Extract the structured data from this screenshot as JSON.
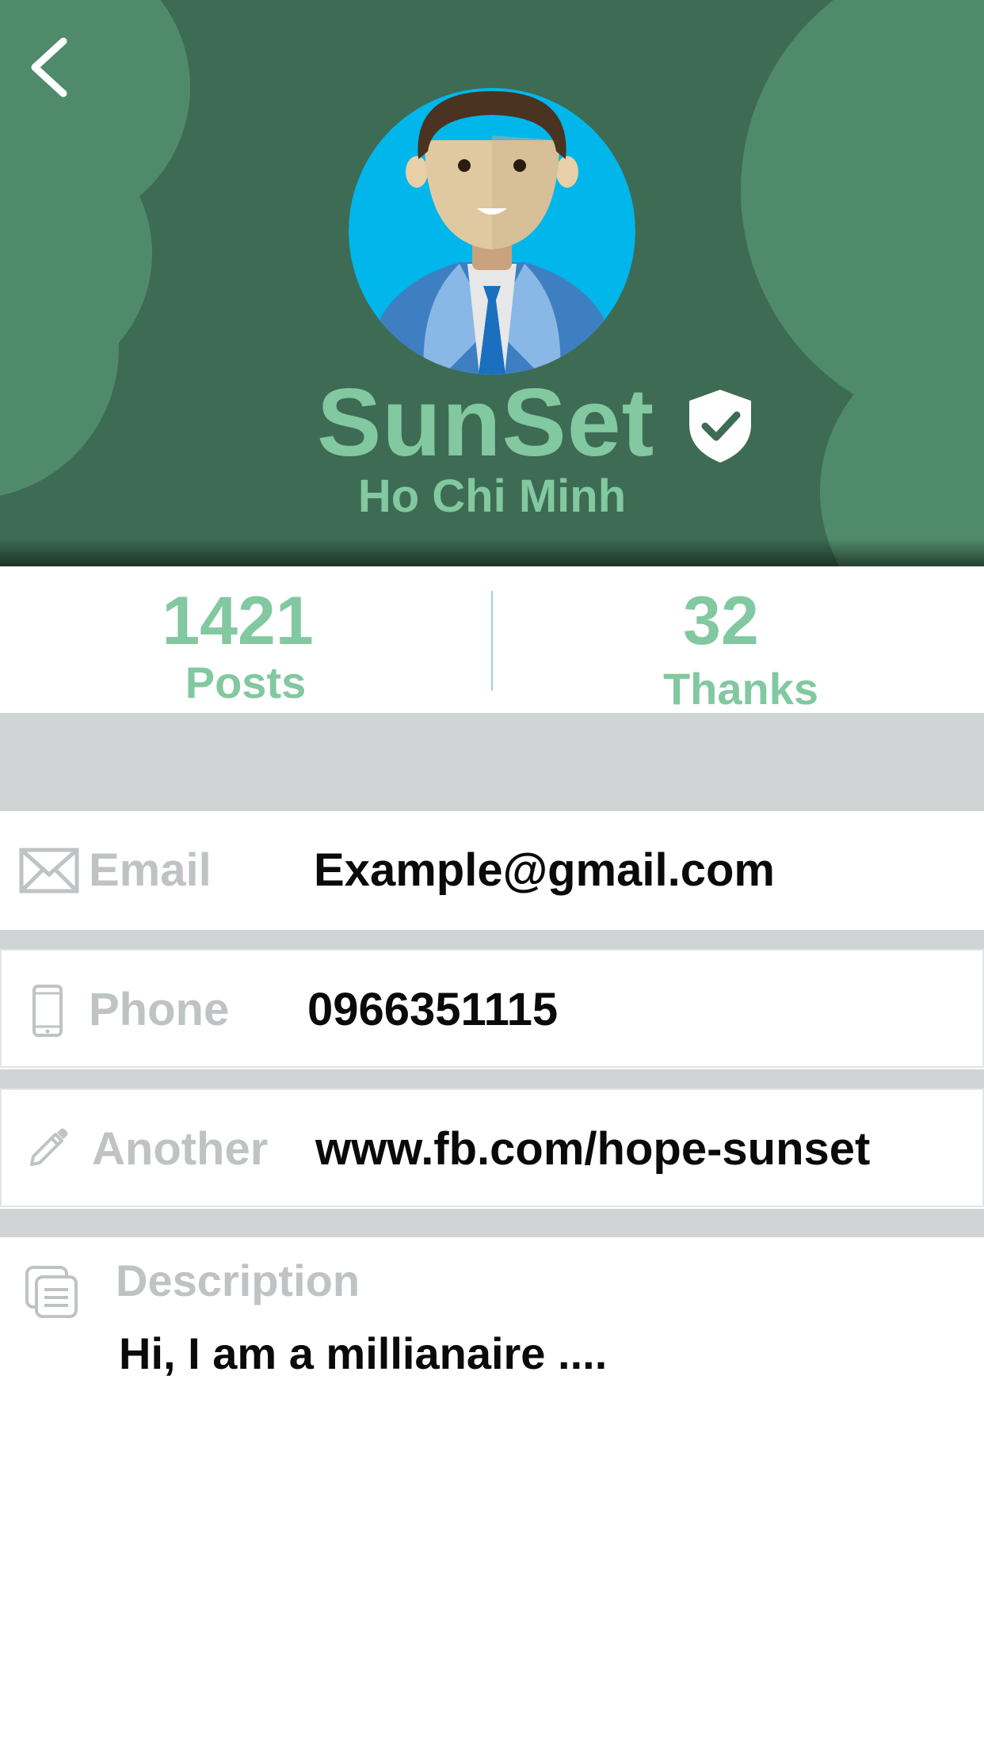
{
  "header": {
    "back_icon": "chevron-left-icon",
    "avatar_icon": "businessman-avatar",
    "name": "SunSet",
    "verified_icon": "shield-check-icon",
    "location": "Ho Chi Minh",
    "colors": {
      "background": "#3e6b53",
      "decoration": "#4f8a6b",
      "accent": "#82c8a0"
    }
  },
  "stats": {
    "posts": {
      "value": "1421",
      "label": "Posts"
    },
    "thanks": {
      "value": "32",
      "label": "Thanks"
    }
  },
  "info": {
    "email": {
      "icon": "envelope-icon",
      "label": "Email",
      "value": "Example@gmail.com"
    },
    "phone": {
      "icon": "phone-icon",
      "label": "Phone",
      "value": "0966351115"
    },
    "another": {
      "icon": "pencil-icon",
      "label": "Another",
      "value": "www.fb.com/hope-sunset"
    }
  },
  "description": {
    "icon": "document-icon",
    "label": "Description",
    "text": "Hi, I am a millianaire ...."
  }
}
